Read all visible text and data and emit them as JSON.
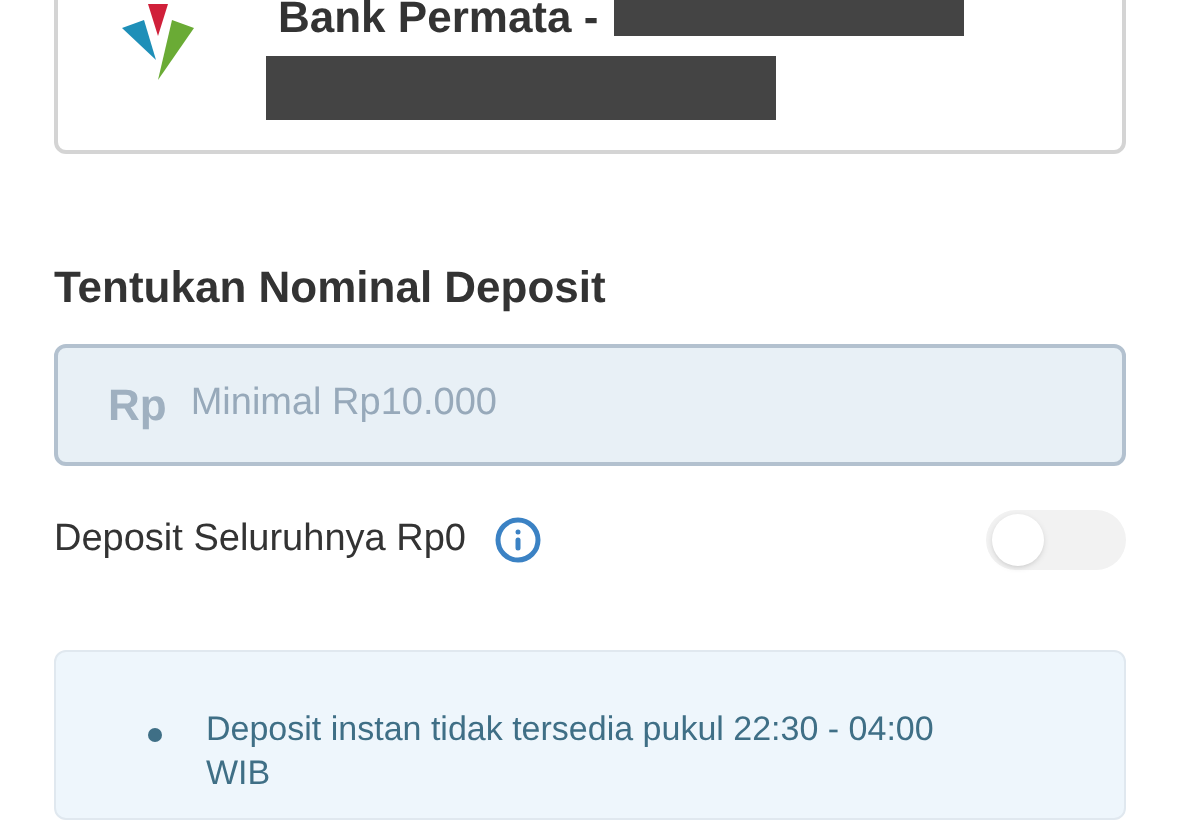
{
  "bank_card": {
    "name": "Bank Permata -",
    "account_redacted": true
  },
  "deposit": {
    "title": "Tentukan Nominal Deposit",
    "prefix": "Rp",
    "placeholder": "Minimal Rp10.000"
  },
  "deposit_all": {
    "label": "Deposit Seluruhnya Rp0",
    "on": false
  },
  "notes": [
    "Deposit instan tidak tersedia pukul 22:30 - 04:00 WIB"
  ]
}
